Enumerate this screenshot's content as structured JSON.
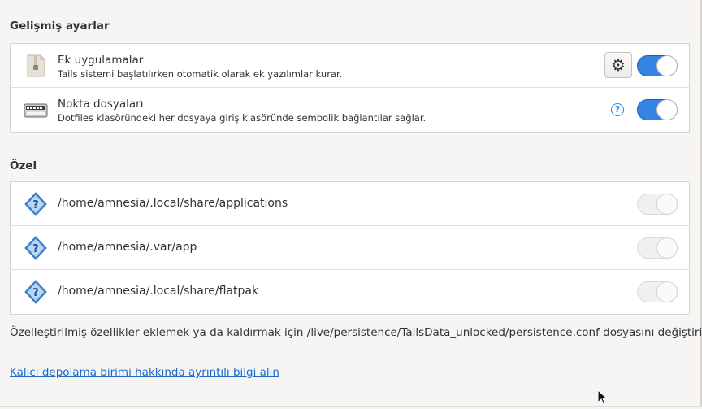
{
  "advanced": {
    "title": "Gelişmiş ayarlar",
    "items": [
      {
        "title": "Ek uygulamalar",
        "description": "Tails sistemi başlatılırken otomatik olarak ek yazılımlar kurar.",
        "icon": "package-icon",
        "action": "gear-icon",
        "enabled": true
      },
      {
        "title": "Nokta dosyaları",
        "description": "Dotfiles klasöründeki her dosyaya giriş klasöründe sembolik bağlantılar sağlar.",
        "icon": "dotfiles-icon",
        "action": "help-icon",
        "action_label": "?",
        "enabled": true
      }
    ]
  },
  "custom": {
    "title": "Özel",
    "items": [
      {
        "path": "/home/amnesia/.local/share/applications",
        "icon": "unknown-folder-icon",
        "enabled": false
      },
      {
        "path": "/home/amnesia/.var/app",
        "icon": "unknown-folder-icon",
        "enabled": false
      },
      {
        "path": "/home/amnesia/.local/share/flatpak",
        "icon": "unknown-folder-icon",
        "enabled": false
      }
    ]
  },
  "info_text": "Özelleştirilmiş özellikler eklemek ya da kaldırmak için /live/persistence/TailsData_unlocked/persistence.conf dosyasını değiştirin.",
  "learn_more_link": "Kalıcı depolama birimi hakkında ayrıntılı bilgi alın",
  "colors": {
    "accent": "#3584e4",
    "link": "#1b6acb"
  }
}
